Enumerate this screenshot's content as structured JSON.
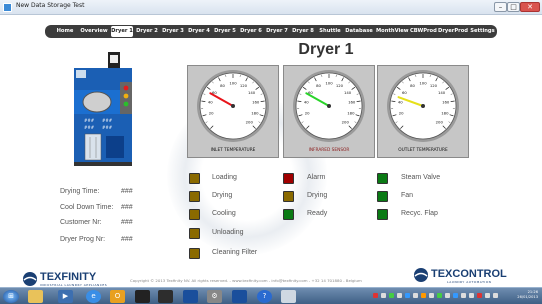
{
  "window": {
    "title": "New Data Storage Test"
  },
  "nav": {
    "items": [
      "Home",
      "Overview",
      "Dryer 1",
      "Dryer 2",
      "Dryer 3",
      "Dryer 4",
      "Dryer 5",
      "Dryer 6",
      "Dryer 7",
      "Dryer 8",
      "Shuttle",
      "Database",
      "MonthView",
      "CBWProd",
      "DryerProd",
      "Settings"
    ],
    "active": "Dryer 1"
  },
  "page": {
    "title": "Dryer 1"
  },
  "gauges": [
    {
      "label": "INLET TEMPERATURE",
      "ticks": [
        "20",
        "40",
        "60",
        "80",
        "100",
        "120",
        "140",
        "160",
        "180",
        "200"
      ],
      "needle_color": "#e8141a",
      "value": 55
    },
    {
      "label": "INFRARED SENSOR",
      "ticks": [
        "20",
        "40",
        "60",
        "80",
        "100",
        "120",
        "140",
        "160",
        "180",
        "200"
      ],
      "needle_color": "#2ad42a",
      "value": 55
    },
    {
      "label": "OUTLET TEMPERATURE",
      "ticks": [
        "20",
        "40",
        "60",
        "80",
        "100",
        "120",
        "140",
        "160",
        "180",
        "200"
      ],
      "needle_color": "#e6e01a",
      "value": 48
    }
  ],
  "info": {
    "drying_time": {
      "label": "Drying Time:",
      "value": "###"
    },
    "cool_down_time": {
      "label": "Cool Down Time:",
      "value": "###"
    },
    "customer_nr": {
      "label": "Customer Nr:",
      "value": "###"
    },
    "dryer_prog_nr": {
      "label": "Dryer Prog Nr:",
      "value": "###"
    }
  },
  "indicators": {
    "col1": [
      {
        "label": "Loading",
        "color": "#8a6a00"
      },
      {
        "label": "Drying",
        "color": "#8a6a00"
      },
      {
        "label": "Cooling",
        "color": "#8a6a00"
      },
      {
        "label": "Unloading",
        "color": "#8a6a00"
      },
      {
        "label": "Cleaning Filter",
        "color": "#8a6a00"
      }
    ],
    "col2": [
      {
        "label": "Alarm",
        "color": "#a00000"
      },
      {
        "label": "Drying",
        "color": "#8a6a00"
      },
      {
        "label": "Ready",
        "color": "#0a7a14"
      }
    ],
    "col3": [
      {
        "label": "Steam Valve",
        "color": "#0a7a14"
      },
      {
        "label": "Fan",
        "color": "#0a7a14"
      },
      {
        "label": "Recyc. Flap",
        "color": "#0a7a14"
      }
    ]
  },
  "footer": {
    "left_logo": "TEXFINITY",
    "left_logo_sub": "INDUSTRIAL LAUNDRY APPLIANCES",
    "right_logo": "TEXCONTROL",
    "right_logo_sub": "LAUNDRY AUTOMATION",
    "copyright": "Copyright © 2013 Texfinity NV. All rights reserved. - www.texfinity.com - info@texfinity.com - +32 14 701880 - Belgium"
  },
  "taskbar": {
    "time": "21:26",
    "date": "26/01/2013"
  },
  "colors": {
    "accent": "#3c3c3c",
    "gauge_bg": "#c6c6c6"
  }
}
